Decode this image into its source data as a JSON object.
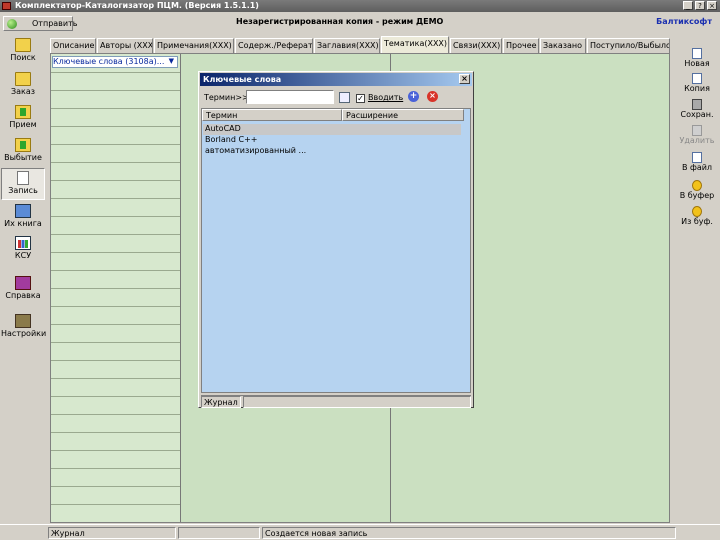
{
  "window": {
    "title": "Комплектатор-Каталогизатор ПЦМ. (Версия 1.5.1.1)",
    "controls": [
      "_",
      "?",
      "×"
    ]
  },
  "topbar": {
    "send_label": "Отправить",
    "notice": "Незарегистрированная копия - режим ДЕМО",
    "brand": "Балтиксофт"
  },
  "left_toolbar": [
    {
      "label": "Поиск",
      "icon": "search-folder-icon"
    },
    {
      "label": "Заказ",
      "icon": "order-folder-icon"
    },
    {
      "label": "Прием",
      "icon": "receive-folder-icon"
    },
    {
      "label": "Выбытие",
      "icon": "withdraw-folder-icon"
    },
    {
      "label": "Запись",
      "icon": "record-page-icon",
      "active": true
    },
    {
      "label": "Их книга",
      "icon": "windows-icon"
    },
    {
      "label": "КСУ",
      "icon": "chart-icon"
    },
    {
      "label": "Справка",
      "icon": "help-book-icon"
    },
    {
      "label": "Настройки",
      "icon": "tools-icon"
    }
  ],
  "tabs": [
    {
      "label": "Описание"
    },
    {
      "label": "Авторы (XXX)"
    },
    {
      "label": "Примечания(XXX)"
    },
    {
      "label": "Содерж./Реферат"
    },
    {
      "label": "Заглавия(XXX)"
    },
    {
      "label": "Тематика(XXX)",
      "selected": true
    },
    {
      "label": "Связи(XXX)"
    },
    {
      "label": "Прочее"
    },
    {
      "label": "Заказано"
    },
    {
      "label": "Поступило/Выбыло"
    }
  ],
  "keyword_select": {
    "value": "Ключевые слова (3108а)..."
  },
  "right_toolbar": [
    {
      "label": "Новая",
      "icon": "new-doc-icon"
    },
    {
      "label": "Копия",
      "icon": "copy-doc-icon"
    },
    {
      "label": "Сохран.",
      "icon": "save-icon"
    },
    {
      "label": "Удалить",
      "icon": "delete-icon",
      "disabled": true
    },
    {
      "label": "В файл",
      "icon": "to-file-icon"
    },
    {
      "label": "В буфер",
      "icon": "to-buffer-icon"
    },
    {
      "label": "Из буф.",
      "icon": "from-buffer-icon"
    }
  ],
  "dialog": {
    "title": "Ключевые слова",
    "term_label": "Термин>>",
    "term_value": "",
    "checkbox_label": "Вводить",
    "checkbox_checked": true,
    "columns": [
      "Термин",
      "Расширение"
    ],
    "rows": [
      "AutoCAD",
      "Borland C++",
      "автоматизированный ..."
    ],
    "selected_row": 0,
    "status": "Журнал"
  },
  "statusbar": {
    "panel1": "Журнал",
    "panel2": "",
    "panel3": "Создается новая запись"
  }
}
